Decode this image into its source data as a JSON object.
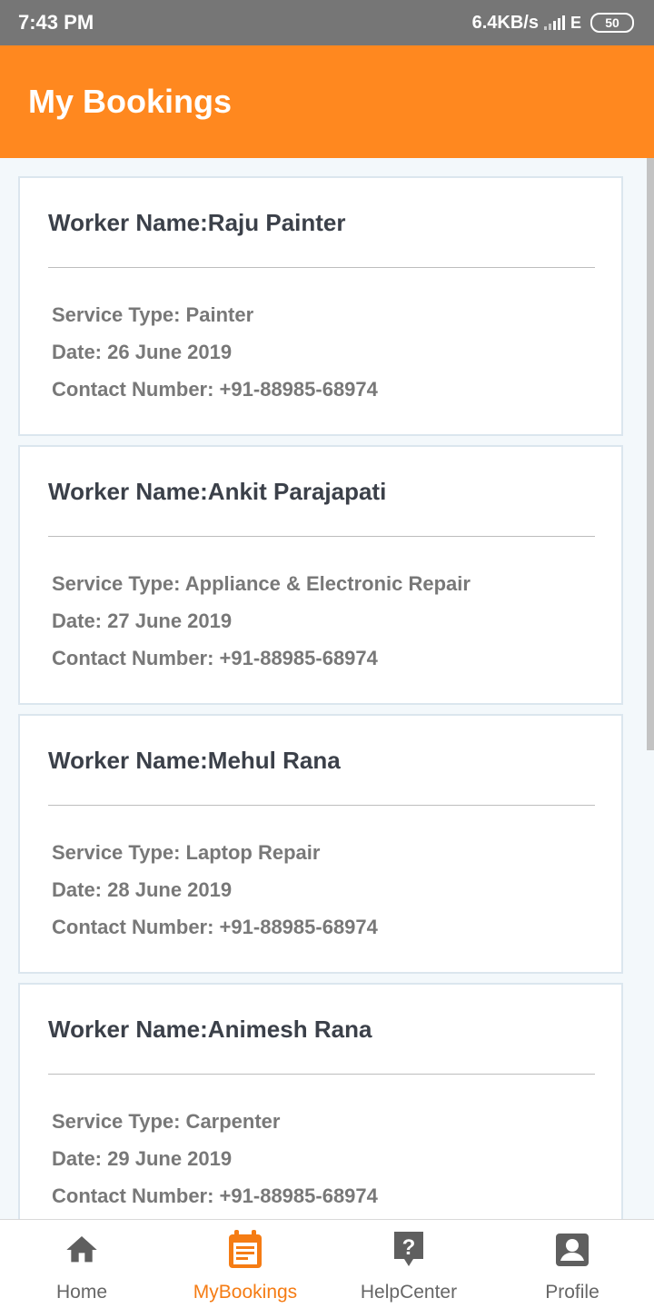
{
  "status_bar": {
    "time": "7:43 PM",
    "network_speed": "6.4KB/s",
    "network_type": "E",
    "battery": "50"
  },
  "app_bar": {
    "title": "My Bookings"
  },
  "bookings": [
    {
      "worker_name": "Worker Name:Raju Painter",
      "service_type": "Service Type: Painter",
      "date": "Date: 26 June 2019",
      "contact": "Contact Number: +91-88985-68974"
    },
    {
      "worker_name": "Worker Name:Ankit Parajapati",
      "service_type": "Service Type: Appliance & Electronic Repair",
      "date": "Date: 27 June 2019",
      "contact": "Contact Number: +91-88985-68974"
    },
    {
      "worker_name": "Worker Name:Mehul Rana",
      "service_type": "Service Type: Laptop Repair",
      "date": "Date: 28 June 2019",
      "contact": "Contact Number: +91-88985-68974"
    },
    {
      "worker_name": "Worker Name:Animesh Rana",
      "service_type": "Service Type: Carpenter",
      "date": "Date: 29 June 2019",
      "contact": "Contact Number: +91-88985-68974"
    }
  ],
  "bottom_nav": [
    {
      "label": "Home",
      "icon": "home-icon",
      "active": false
    },
    {
      "label": "MyBookings",
      "icon": "calendar-icon",
      "active": true
    },
    {
      "label": "HelpCenter",
      "icon": "help-icon",
      "active": false
    },
    {
      "label": "Profile",
      "icon": "profile-icon",
      "active": false
    }
  ],
  "colors": {
    "accent": "#ff881f",
    "active_nav": "#f57c14",
    "inactive_nav": "#666666",
    "status_bar": "#767676"
  }
}
